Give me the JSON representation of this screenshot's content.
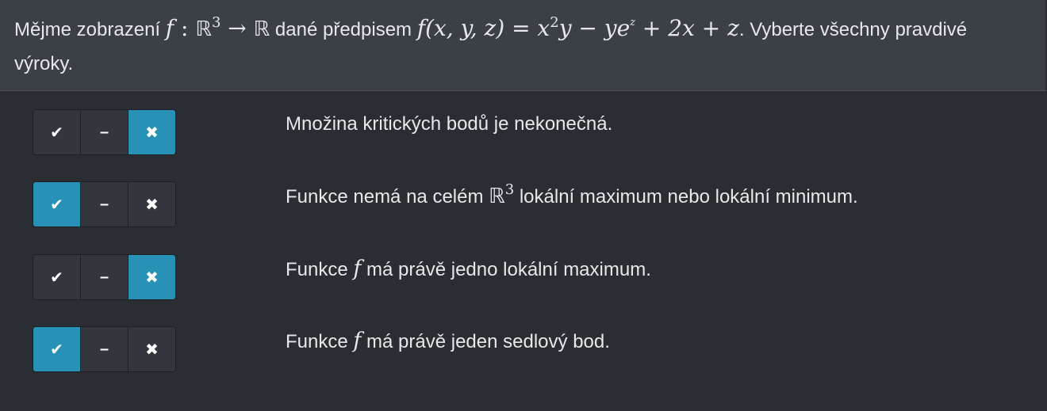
{
  "question": {
    "text_before": "Mějme zobrazení ",
    "math_map": "f",
    "math_colon": " : ",
    "math_domain": "ℝ",
    "math_domain_exp": "3",
    "math_arrow": " → ",
    "math_codomain": "ℝ",
    "text_mid": " dané předpisem ",
    "math_formula_a": "f(x, y, z) = x",
    "math_formula_a_exp": "2",
    "math_formula_b": "y − ye",
    "math_formula_b_exp": "z",
    "math_formula_c": " + 2x + z",
    "text_after": ". Vyberte všechny pravdivé výroky."
  },
  "toggle_icons": [
    "✔",
    "–",
    "✖"
  ],
  "statements": [
    {
      "selected": "false",
      "parts": [
        "Množina kritických bodů je nekonečná."
      ]
    },
    {
      "selected": "true",
      "parts": [
        "Funkce nemá na celém ",
        "ℝ",
        "3",
        " lokální maximum nebo lokální minimum."
      ]
    },
    {
      "selected": "false",
      "parts": [
        "Funkce ",
        "f",
        " má právě jedno lokální maximum."
      ]
    },
    {
      "selected": "true",
      "parts": [
        "Funkce ",
        "f",
        " má právě jeden sedlový bod."
      ]
    }
  ],
  "colors": {
    "accent": "#2792b6",
    "header_bg": "#3b4047",
    "body_bg": "#2a2e33",
    "button_bg": "#33373d"
  }
}
